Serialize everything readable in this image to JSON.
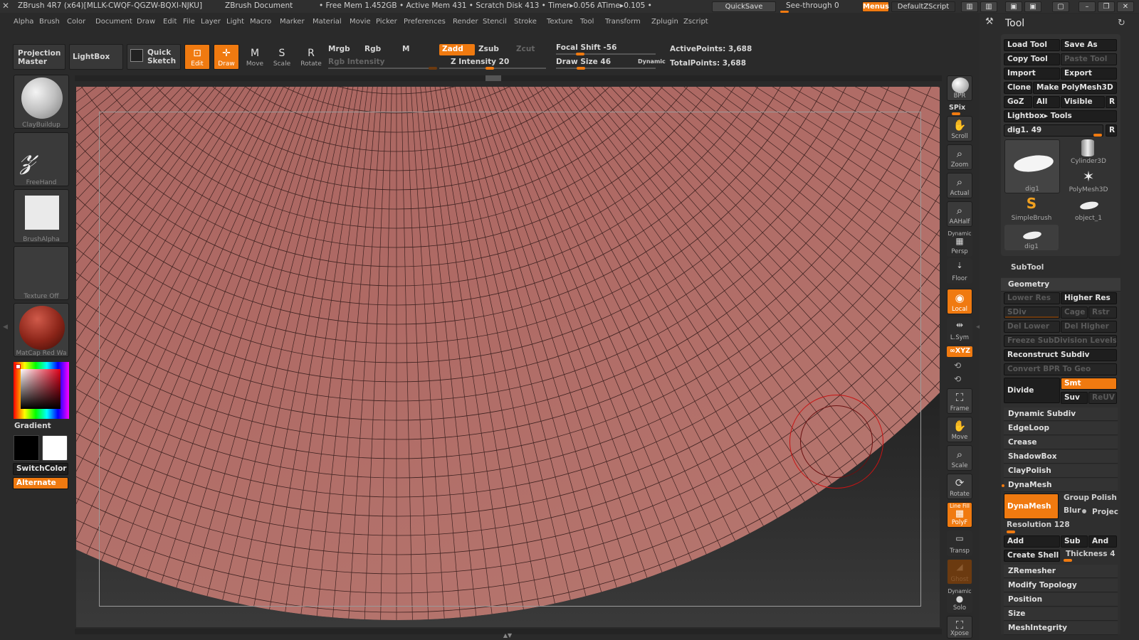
{
  "titlebar": {
    "app_title": "ZBrush 4R7 (x64)[MLLK-CWQF-QGZW-BQXI-NJKU]",
    "document": "ZBrush Document",
    "stats": "• Free Mem 1.452GB • Active Mem 431 • Scratch Disk 413 • Timer▸0.056 ATime▸0.105 •",
    "quicksave": "QuickSave",
    "see_through": "See-through  0",
    "menus": "Menus",
    "default_zscript": "DefaultZScript"
  },
  "menubar": {
    "items": [
      "Alpha",
      "Brush",
      "Color",
      "Document",
      "Draw",
      "Edit",
      "File",
      "Layer",
      "Light",
      "Macro",
      "Marker",
      "Material",
      "Movie",
      "Picker",
      "Preferences",
      "Render",
      "Stencil",
      "Stroke",
      "Texture",
      "Tool",
      "Transform",
      "Zplugin",
      "Zscript"
    ]
  },
  "toolbar": {
    "projection_master": "Projection Master",
    "lightbox": "LightBox",
    "quick_sketch": "Quick Sketch",
    "edit": "Edit",
    "draw": "Draw",
    "move": "Move",
    "scale": "Scale",
    "rotate": "Rotate",
    "mrgb": "Mrgb",
    "rgb": "Rgb",
    "m": "M",
    "rgb_intensity": "Rgb  Intensity",
    "zadd": "Zadd",
    "zsub": "Zsub",
    "zcut": "Zcut",
    "z_intensity": "Z Intensity 20",
    "focal_shift": "Focal Shift -56",
    "draw_size": "Draw Size 46",
    "dynamic": "Dynamic",
    "active_points": "ActivePoints: 3,688",
    "total_points": "TotalPoints: 3,688"
  },
  "left_tray": {
    "brush": "ClayBuildup",
    "stroke": "FreeHand",
    "alpha": "BrushAlpha",
    "texture": "Texture  Off",
    "material": "MatCap Red Wa",
    "gradient": "Gradient",
    "switch_color": "SwitchColor",
    "alternate": "Alternate"
  },
  "right_shelf": {
    "bpr": "BPR",
    "spix": "SPix",
    "scroll": "Scroll",
    "zoom": "Zoom",
    "actual": "Actual",
    "aahalf": "AAHalf",
    "persp": "Persp",
    "dynamic_small": "Dynamic",
    "floor": "Floor",
    "local": "Local",
    "lsym": "L.Sym",
    "xyz": "∞XYZ",
    "frame": "Frame",
    "move": "Move",
    "scale": "Scale",
    "rotate": "Rotate",
    "polyf": "PolyF",
    "line_fill": "Line Fill",
    "transp": "Transp",
    "ghost": "Ghost",
    "solo": "Solo",
    "xpose": "Xpose"
  },
  "tool_panel": {
    "title": "Tool",
    "load_tool": "Load Tool",
    "save_as": "Save As",
    "copy_tool": "Copy Tool",
    "paste_tool": "Paste Tool",
    "import": "Import",
    "export": "Export",
    "clone": "Clone",
    "make_polymesh": "Make PolyMesh3D",
    "goz": "GoZ",
    "all": "All",
    "visible": "Visible",
    "r": "R",
    "lightbox_tools": "Lightbox▸ Tools",
    "current_tool": "dig1. 49",
    "tools": [
      "dig1",
      "Cylinder3D",
      "PolyMesh3D",
      "SimpleBrush",
      "object_1",
      "dig1"
    ],
    "subtool": "SubTool",
    "geometry": "Geometry",
    "lower_res": "Lower Res",
    "higher_res": "Higher Res",
    "sdiv": "SDiv",
    "cage": "Cage",
    "rstr": "Rstr",
    "del_lower": "Del Lower",
    "del_higher": "Del Higher",
    "freeze_subdiv": "Freeze SubDivision Levels",
    "reconstruct_subdiv": "Reconstruct Subdiv",
    "convert_bpr": "Convert BPR To Geo",
    "divide": "Divide",
    "smt": "Smt",
    "suv": "Suv",
    "reuv": "ReUV",
    "sections": [
      "Dynamic Subdiv",
      "EdgeLoop",
      "Crease",
      "ShadowBox",
      "ClayPolish",
      "DynaMesh"
    ],
    "dynamesh_btn": "DynaMesh",
    "group": "Group",
    "polish": "Polish",
    "blur": "Blur",
    "project": "Projec",
    "resolution": "Resolution 128",
    "add": "Add",
    "sub": "Sub",
    "and": "And",
    "create_shell": "Create Shell",
    "thickness": "Thickness 4",
    "bottom_sections": [
      "ZRemesher",
      "Modify Topology",
      "Position",
      "Size",
      "MeshIntegrity"
    ]
  },
  "colors": {
    "accent": "#f07a10",
    "mesh": "#a8645f",
    "brush_ring": "#c81414"
  }
}
